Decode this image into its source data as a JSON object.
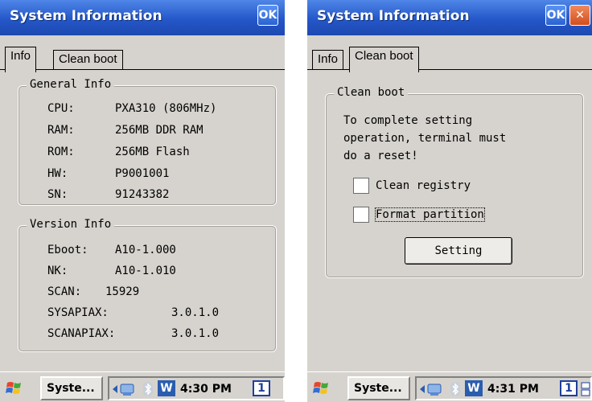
{
  "screen1": {
    "title": "System Information",
    "ok_label": "OK",
    "tabs": [
      "Info",
      "Clean boot"
    ],
    "general_info": {
      "label": "General Info",
      "rows": [
        {
          "key": "CPU:",
          "value": "PXA310 (806MHz)"
        },
        {
          "key": "RAM:",
          "value": "256MB DDR RAM"
        },
        {
          "key": "ROM:",
          "value": "256MB Flash"
        },
        {
          "key": "HW:",
          "value": "P9001001"
        },
        {
          "key": "SN:",
          "value": "91243382"
        }
      ]
    },
    "version_info": {
      "label": "Version Info",
      "rows": [
        {
          "key": "Eboot:",
          "value": "A10-1.000"
        },
        {
          "key": "NK:",
          "value": "A10-1.010"
        },
        {
          "key": "SCAN:",
          "value": "15929"
        },
        {
          "key": "SYSAPIAX:",
          "value": "3.0.1.0"
        },
        {
          "key": "SCANAPIAX:",
          "value": "3.0.1.0"
        }
      ]
    },
    "taskbar": {
      "task": "Syste...",
      "time": "4:30 PM",
      "keyboard": "1"
    }
  },
  "screen2": {
    "title": "System Information",
    "ok_label": "OK",
    "close_label": "✕",
    "tabs": [
      "Info",
      "Clean boot"
    ],
    "clean_boot": {
      "label": "Clean boot",
      "message": [
        "To complete setting",
        "operation, terminal must",
        "do a reset!"
      ],
      "checkbox_registry": "Clean registry",
      "checkbox_partition": "Format partition",
      "setting_button": "Setting"
    },
    "taskbar": {
      "task": "Syste...",
      "time": "4:31 PM",
      "keyboard": "1"
    }
  },
  "colors": {
    "titlebar": "#2457c9",
    "window_bg": "#d6d3ce",
    "close_button": "#d24e1e"
  }
}
